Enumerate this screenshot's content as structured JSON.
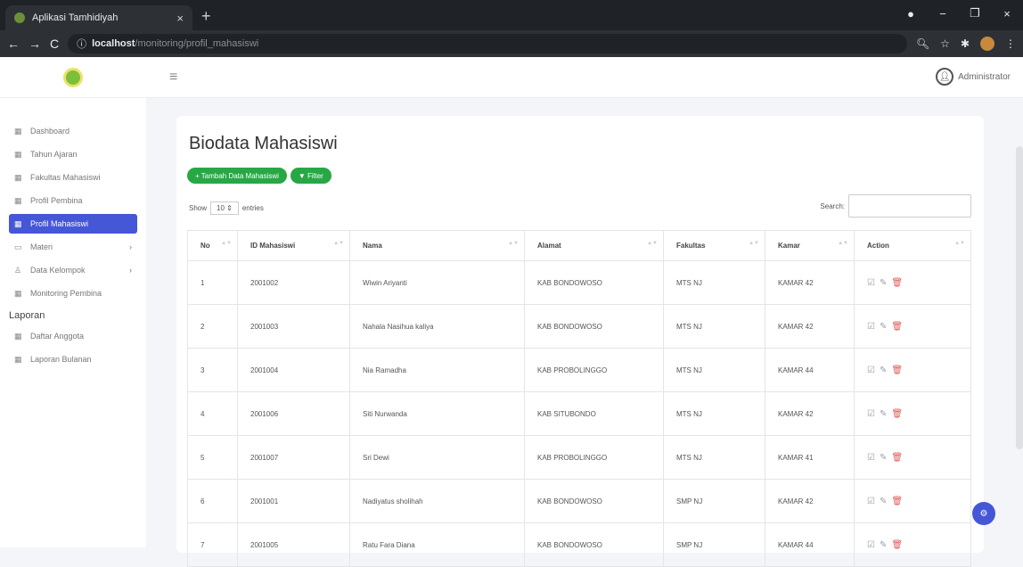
{
  "browser": {
    "tab_title": "Aplikasi Tamhidiyah",
    "tab_close": "×",
    "new_tab": "+",
    "url_host": "localhost",
    "url_path": "/monitoring/profil_mahasiswi",
    "min": "−",
    "max": "❐",
    "close": "×"
  },
  "topbar": {
    "username": "Administrator"
  },
  "sidebar": {
    "items": [
      {
        "label": "Dashboard"
      },
      {
        "label": "Tahun Ajaran"
      },
      {
        "label": "Fakultas Mahasiswi"
      },
      {
        "label": "Profil Pembina"
      },
      {
        "label": "Profil Mahasiswi"
      },
      {
        "label": "Materi"
      },
      {
        "label": "Data Kelompok"
      },
      {
        "label": "Monitoring Pembina"
      }
    ],
    "section": "Laporan",
    "report_items": [
      {
        "label": "Daftar Anggota"
      },
      {
        "label": "Laporan Bulanan"
      }
    ]
  },
  "main": {
    "title": "Biodata Mahasiswi",
    "add_button": "+ Tambah Data Mahasiswi",
    "filter_button": "▼ Filter",
    "show_label": "Show",
    "show_value": "10",
    "entries_label": "entries",
    "search_label": "Search:"
  },
  "table": {
    "headers": [
      "No",
      "ID Mahasiswi",
      "Nama",
      "Alamat",
      "Fakultas",
      "Kamar",
      "Action"
    ],
    "rows": [
      [
        "1",
        "2001002",
        "Wiwin Ariyanti",
        "KAB BONDOWOSO",
        "MTS NJ",
        "KAMAR 42"
      ],
      [
        "2",
        "2001003",
        "Nahala Nasihua kaliya",
        "KAB BONDOWOSO",
        "MTS NJ",
        "KAMAR 42"
      ],
      [
        "3",
        "2001004",
        "Nia Ramadha",
        "KAB PROBOLINGGO",
        "MTS NJ",
        "KAMAR 44"
      ],
      [
        "4",
        "2001006",
        "Siti Nurwanda",
        "KAB SITUBONDO",
        "MTS NJ",
        "KAMAR 42"
      ],
      [
        "5",
        "2001007",
        "Sri Dewi",
        "KAB PROBOLINGGO",
        "MTS NJ",
        "KAMAR 41"
      ],
      [
        "6",
        "2001001",
        "Nadiyatus sholihah",
        "KAB BONDOWOSO",
        "SMP NJ",
        "KAMAR 42"
      ],
      [
        "7",
        "2001005",
        "Ratu Fara Diana",
        "KAB BONDOWOSO",
        "SMP NJ",
        "KAMAR 44"
      ]
    ]
  }
}
